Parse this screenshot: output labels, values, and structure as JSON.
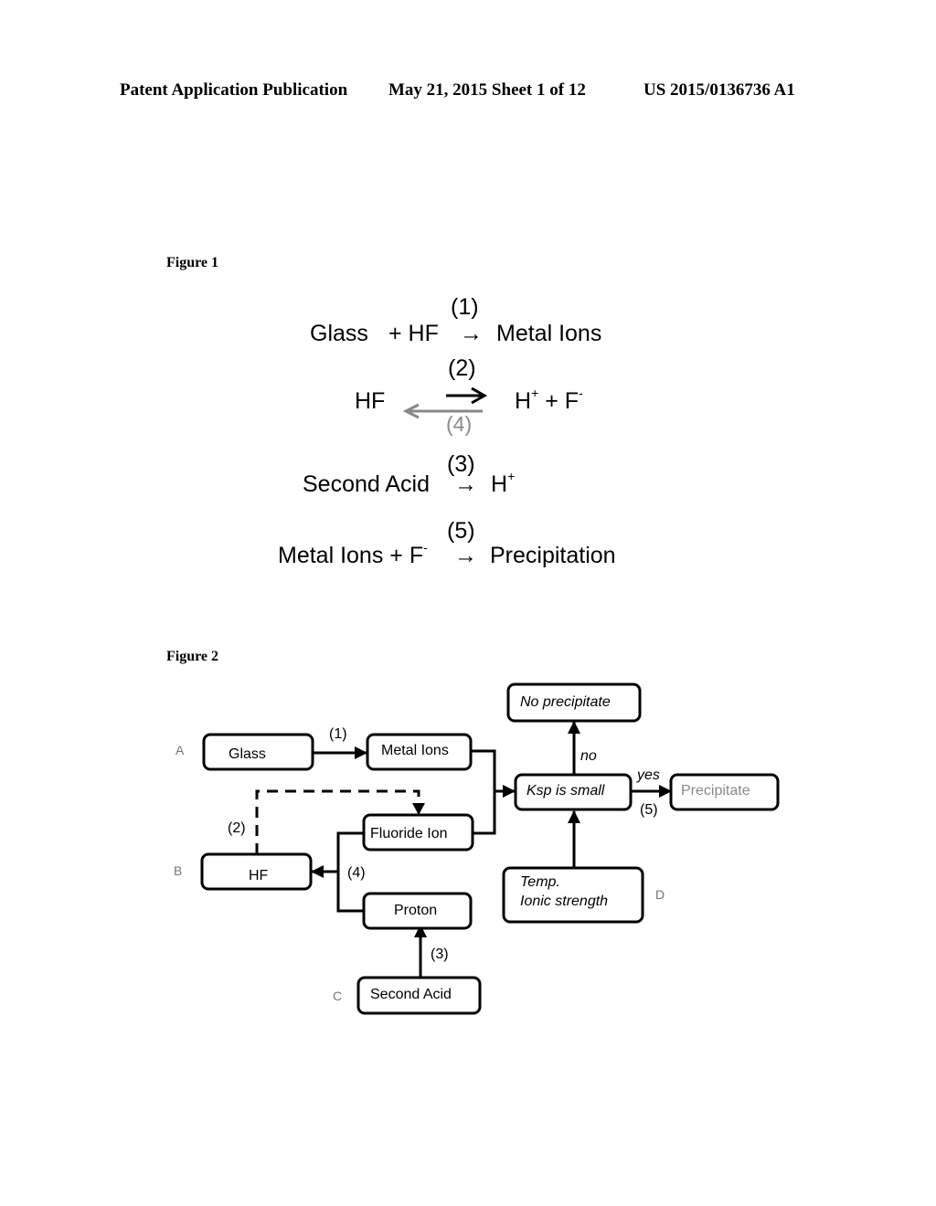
{
  "header": {
    "publication": "Patent Application Publication",
    "date_sheet": "May 21, 2015  Sheet 1 of 12",
    "number": "US 2015/0136736 A1"
  },
  "figure1": {
    "label": "Figure 1",
    "reactions": [
      {
        "num": "(1)",
        "left": "Glass",
        "plus_reagent": "+ HF",
        "arrow": "→",
        "right": "Metal Ions"
      },
      {
        "num": "(2)",
        "reverse_num": "(4)",
        "left": "HF",
        "right_h": "H",
        "right_h_sup": "+",
        "right_plus": " + F",
        "right_f_sup": "-"
      },
      {
        "num": "(3)",
        "left": "Second Acid",
        "arrow": "→",
        "right": "H",
        "right_sup": "+"
      },
      {
        "num": "(5)",
        "left": "Metal Ions + F",
        "left_sup": "-",
        "arrow": "→",
        "right": "Precipitation"
      }
    ]
  },
  "figure2": {
    "label": "Figure 2",
    "row_labels": {
      "a": "A",
      "b": "B",
      "c": "C",
      "d": "D"
    },
    "nodes": {
      "glass": "Glass",
      "metal_ions": "Metal Ions",
      "fluoride_ion": "Fluoride Ion",
      "hf": "HF",
      "proton": "Proton",
      "second_acid": "Second Acid",
      "ksp": "Ksp is small",
      "no_precipitate": "No precipitate",
      "precipitate": "Precipitate",
      "conditions_line1": "Temp.",
      "conditions_line2": "Ionic strength"
    },
    "edge_labels": {
      "e1": "(1)",
      "e2": "(2)",
      "e3": "(3)",
      "e4": "(4)",
      "e5": "(5)",
      "yes": "yes",
      "no": "no"
    }
  }
}
